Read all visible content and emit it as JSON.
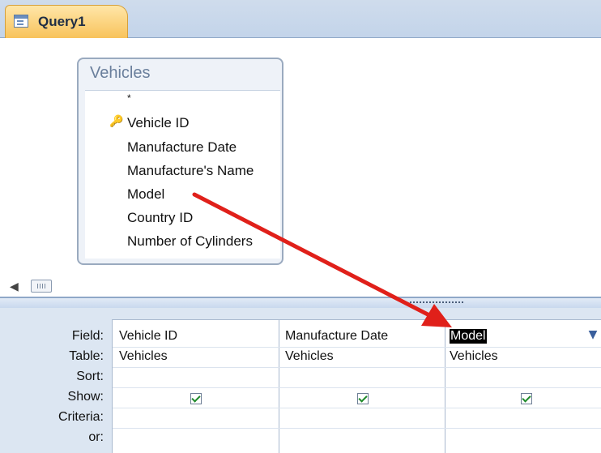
{
  "tab": {
    "title": "Query1"
  },
  "table": {
    "name": "Vehicles",
    "fields": [
      "*",
      "Vehicle ID",
      "Manufacture Date",
      "Manufacture's Name",
      "Model",
      "Country ID",
      "Number of Cylinders"
    ]
  },
  "grid": {
    "row_labels": [
      "Field:",
      "Table:",
      "Sort:",
      "Show:",
      "Criteria:",
      "or:"
    ],
    "columns": [
      {
        "field": "Vehicle ID",
        "table": "Vehicles",
        "show": true
      },
      {
        "field": "Manufacture Date",
        "table": "Vehicles",
        "show": true
      },
      {
        "field": "Model",
        "table": "Vehicles",
        "show": true
      }
    ]
  },
  "colors": {
    "arrow": "#e0201a",
    "tab": "#f8c35c",
    "grid_bg": "#dce6f2"
  }
}
